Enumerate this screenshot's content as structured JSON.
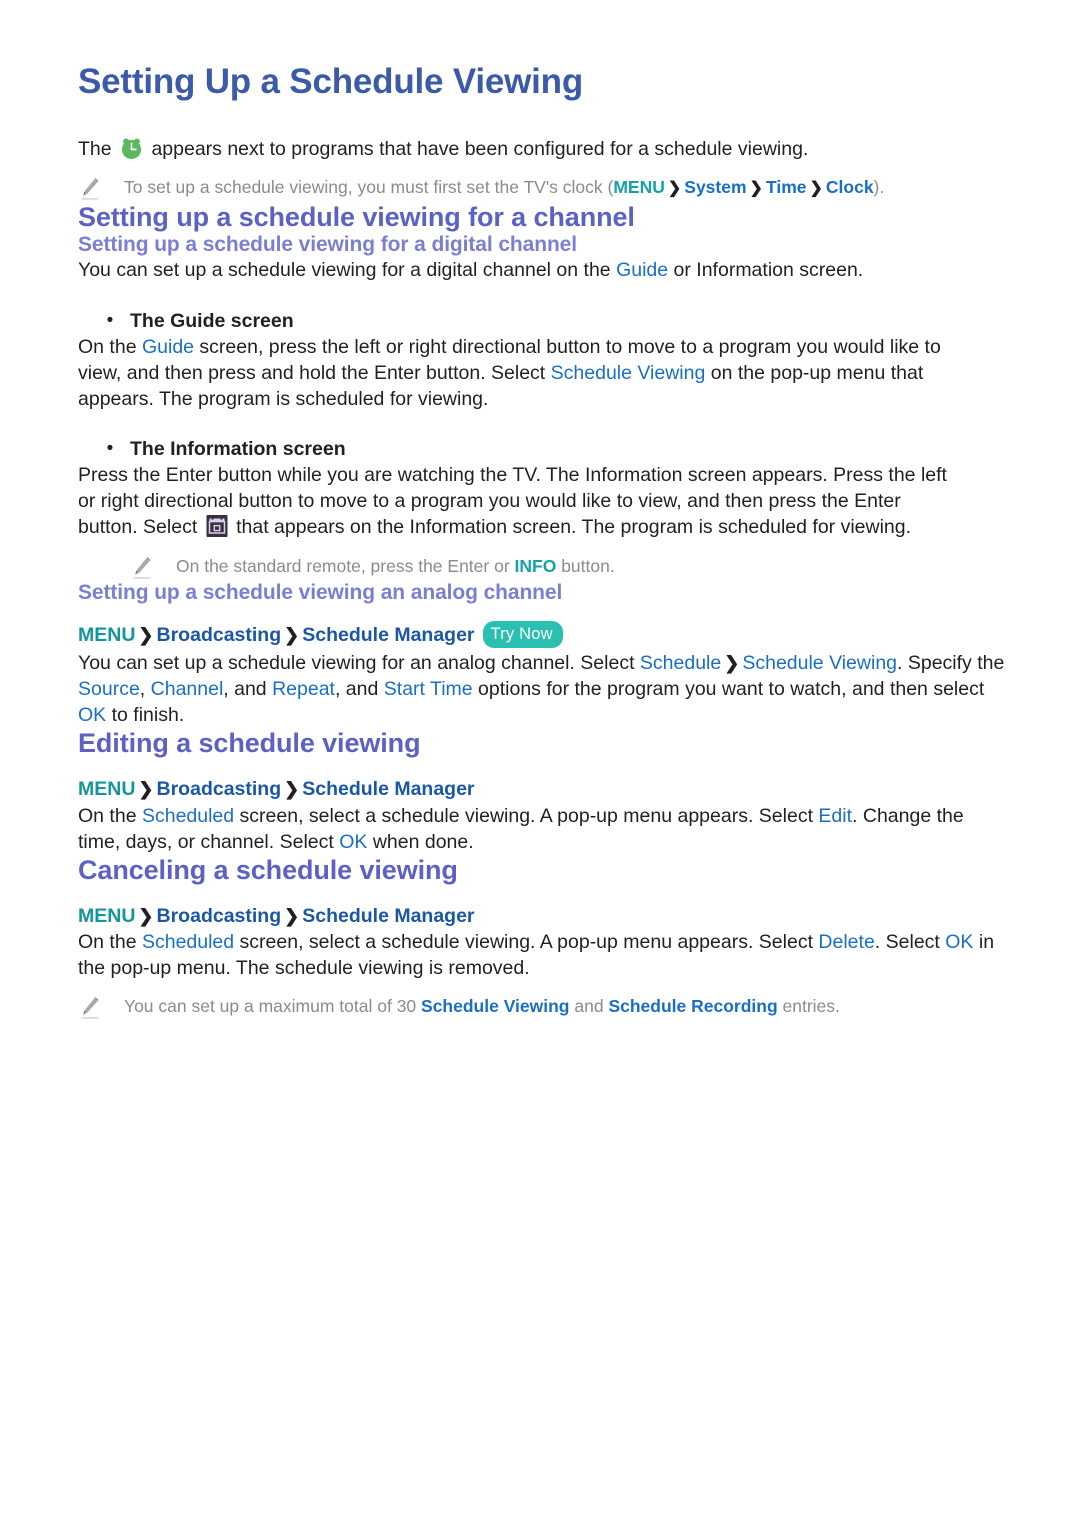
{
  "page": {
    "title": "Setting Up a Schedule Viewing",
    "intro": {
      "before_icon": "The ",
      "icon": "green-alarm-clock-icon",
      "after_icon": " appears next to programs that have been configured for a schedule viewing."
    },
    "note_clock": {
      "icon": "pencil-note-icon",
      "text_1": "To set up a schedule viewing, you must first set the TV's clock (",
      "path": [
        "MENU",
        "System",
        "Time",
        "Clock"
      ],
      "text_2": ")."
    }
  },
  "section_channel": {
    "heading": "Setting up a schedule viewing for a channel",
    "digital": {
      "heading": "Setting up a schedule viewing for a digital channel",
      "intro_1": "You can set up a schedule viewing for a digital channel on the ",
      "intro_term": "Guide",
      "intro_2": " or Information screen.",
      "bullet_guide": {
        "label": "The Guide screen",
        "text_1": "On the ",
        "term_1": "Guide",
        "text_2": " screen, press the left or right directional button to move to a program you would like to view, and then press and hold the Enter button. Select ",
        "term_2": "Schedule Viewing",
        "text_3": " on the pop-up menu that appears. The program is scheduled for viewing."
      },
      "bullet_information": {
        "label": "The Information screen",
        "text_1": "Press the Enter button while you are watching the TV. The Information screen appears. Press the left or right directional button to move to a program you would like to view, and then press the Enter button. Select ",
        "icon": "calendar-schedule-icon",
        "text_2": " that appears on the Information screen. The program is scheduled for viewing."
      },
      "note_remote": {
        "icon": "pencil-note-icon",
        "text_1": "On the standard remote, press the Enter or ",
        "term": "INFO",
        "text_2": " button."
      }
    },
    "analog": {
      "heading": "Setting up a schedule viewing an analog channel",
      "path": [
        "MENU",
        "Broadcasting",
        "Schedule Manager"
      ],
      "try_now": "Try Now",
      "body_1": "You can set up a schedule viewing for an analog channel. Select ",
      "term_schedule": "Schedule",
      "term_schedule_viewing": "Schedule Viewing",
      "body_2": ". Specify the ",
      "term_source": "Source",
      "term_channel": "Channel",
      "term_repeat": "Repeat",
      "body_3": ", and ",
      "term_start_time": "Start Time",
      "body_4": " options for the program you want to watch, and then select ",
      "term_ok": "OK",
      "body_5": " to finish."
    }
  },
  "section_editing": {
    "heading": "Editing a schedule viewing",
    "path": [
      "MENU",
      "Broadcasting",
      "Schedule Manager"
    ],
    "body_1": "On the ",
    "term_scheduled": "Scheduled",
    "body_2": " screen, select a schedule viewing. A pop-up menu appears. Select ",
    "term_edit": "Edit",
    "body_3": ". Change the time, days, or channel. Select ",
    "term_ok": "OK",
    "body_4": " when done."
  },
  "section_canceling": {
    "heading": "Canceling a schedule viewing",
    "path": [
      "MENU",
      "Broadcasting",
      "Schedule Manager"
    ],
    "body_1": "On the ",
    "term_scheduled": "Scheduled",
    "body_2": " screen, select a schedule viewing. A pop-up menu appears. Select ",
    "term_delete": "Delete",
    "body_3": ". Select ",
    "term_ok": "OK",
    "body_4": " in the pop-up menu. The schedule viewing is removed.",
    "note_max": {
      "icon": "pencil-note-icon",
      "text_1": "You can set up a maximum total of 30 ",
      "term_1": "Schedule Viewing",
      "text_2": " and ",
      "term_2": "Schedule Recording",
      "text_3": " entries."
    }
  },
  "colors": {
    "title_blue": "#3b5aa8",
    "h2_purple": "#5b62c4",
    "h3_light_purple": "#7b7fd0",
    "term_blue": "#1a6fc4",
    "menu_teal": "#12979c",
    "try_now_bg": "#2bbfb1",
    "note_gray": "#8b8b8b",
    "clock_green": "#5bb85b",
    "body_black": "#231f20"
  },
  "chevron": "❯"
}
